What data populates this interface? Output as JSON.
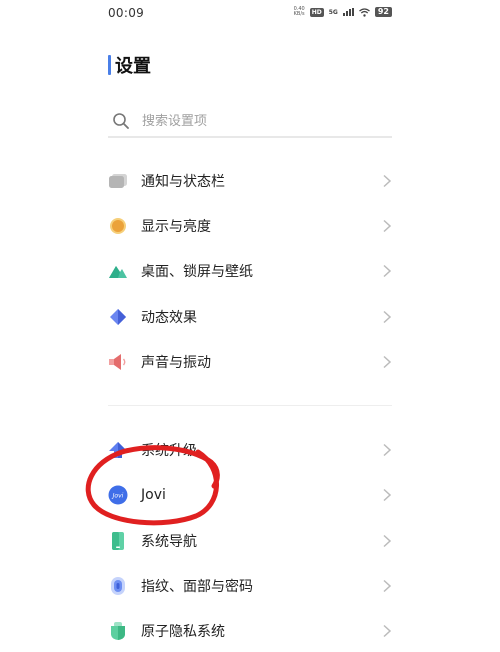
{
  "status_bar": {
    "time": "00:09",
    "net_speed_value": "0.40",
    "net_speed_unit": "KB/s",
    "hd_badge": "HD",
    "signal_label": "5G",
    "battery": "92"
  },
  "header": {
    "title": "设置"
  },
  "search": {
    "placeholder": "搜索设置项"
  },
  "settings": {
    "group1": [
      {
        "label": "通知与状态栏",
        "icon": "notification-bar-icon"
      },
      {
        "label": "显示与亮度",
        "icon": "brightness-icon"
      },
      {
        "label": "桌面、锁屏与壁纸",
        "icon": "wallpaper-mountain-icon"
      },
      {
        "label": "动态效果",
        "icon": "animation-diamond-icon"
      },
      {
        "label": "声音与振动",
        "icon": "speaker-icon"
      }
    ],
    "group2": [
      {
        "label": "系统升级",
        "icon": "system-update-arrow-icon"
      },
      {
        "label": "Jovi",
        "icon": "jovi-icon",
        "icon_text": "Jovi"
      },
      {
        "label": "系统导航",
        "icon": "phone-navigation-icon"
      },
      {
        "label": "指纹、面部与密码",
        "icon": "fingerprint-icon"
      },
      {
        "label": "原子隐私系统",
        "icon": "privacy-shield-icon"
      }
    ]
  },
  "colors": {
    "accent": "#4a7fe8",
    "annotation": "#e02020"
  }
}
